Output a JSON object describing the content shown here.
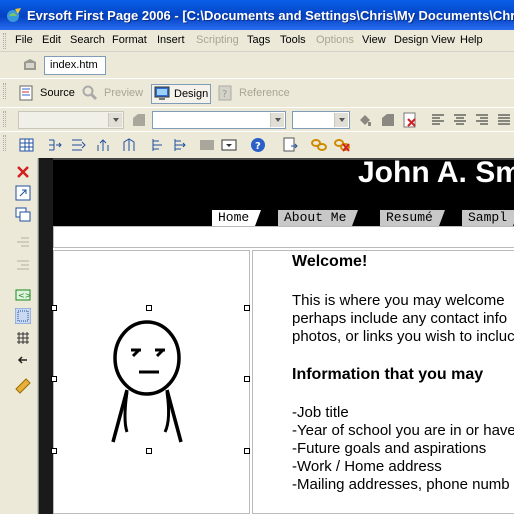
{
  "window": {
    "title": "Evrsoft First Page 2006 - [C:\\Documents and Settings\\Chris\\My Documents\\Chris"
  },
  "menu": [
    "File",
    "Edit",
    "Search",
    "Format",
    "Insert",
    "Scripting",
    "Tags",
    "Tools",
    "Options",
    "View",
    "Design View",
    "Help"
  ],
  "menu_disabled": [
    "Scripting",
    "Options"
  ],
  "doc_tab": {
    "filename": "index.htm"
  },
  "modes": {
    "source": "Source",
    "preview": "Preview",
    "design": "Design",
    "reference": "Reference"
  },
  "active_mode": "Design",
  "page": {
    "site_name": "John A. Sm",
    "nav": [
      "Home",
      "About Me",
      "Resumé",
      "Sampl"
    ],
    "current_nav": "Home",
    "welcome_heading": "Welcome!",
    "intro_lines": [
      "This is where you may welcome",
      "perhaps include any contact info",
      "photos, or links you wish to incluc"
    ],
    "info_heading": "Information that you may",
    "info_items": [
      "-Job title",
      "-Year of school you are in or have",
      "-Future goals and aspirations",
      "-Work / Home address",
      "-Mailing addresses, phone numb"
    ],
    "image_description": "stick figure"
  },
  "colors": {
    "titlebar": "#0a5fe8",
    "chrome": "#ece9d8",
    "page_header": "#000000",
    "nav_tab": "#c8c8c8"
  }
}
